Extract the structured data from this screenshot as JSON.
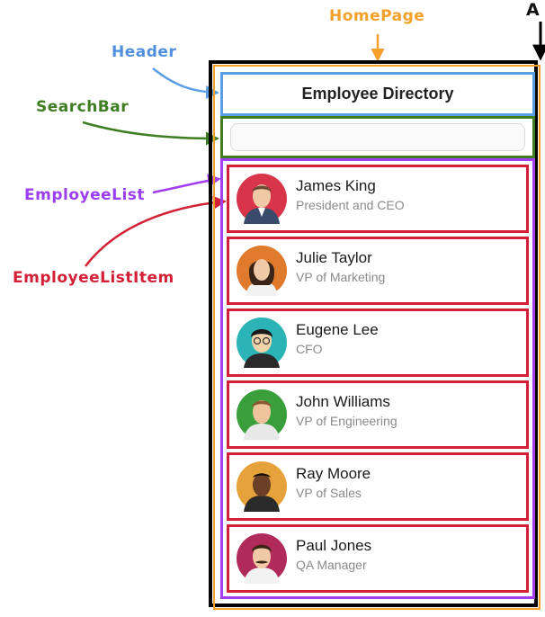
{
  "annotations": {
    "homepage": "HomePage",
    "app": "A",
    "header": "Header",
    "searchbar": "SearchBar",
    "employee_list": "EmployeeList",
    "employee_list_item": "EmployeeListItem"
  },
  "colors": {
    "homepage": "#f5a02a",
    "header": "#5b9ee4",
    "searchbar": "#3f7d22",
    "employee_list": "#a33ef0",
    "employee_list_item": "#d42036"
  },
  "header": {
    "title": "Employee Directory"
  },
  "search": {
    "value": "",
    "placeholder": ""
  },
  "employees": [
    {
      "name": "James King",
      "title": "President and CEO",
      "avatar_icon": "avatar-james-king-icon",
      "avatar_bg": "#d8344a"
    },
    {
      "name": "Julie Taylor",
      "title": "VP of Marketing",
      "avatar_icon": "avatar-julie-taylor-icon",
      "avatar_bg": "#e07a2c"
    },
    {
      "name": "Eugene Lee",
      "title": "CFO",
      "avatar_icon": "avatar-eugene-lee-icon",
      "avatar_bg": "#2bb3b5"
    },
    {
      "name": "John Williams",
      "title": "VP of Engineering",
      "avatar_icon": "avatar-john-williams-icon",
      "avatar_bg": "#3a9e3a"
    },
    {
      "name": "Ray Moore",
      "title": "VP of Sales",
      "avatar_icon": "avatar-ray-moore-icon",
      "avatar_bg": "#e6a23a"
    },
    {
      "name": "Paul Jones",
      "title": "QA Manager",
      "avatar_icon": "avatar-paul-jones-icon",
      "avatar_bg": "#b02a5a"
    }
  ]
}
